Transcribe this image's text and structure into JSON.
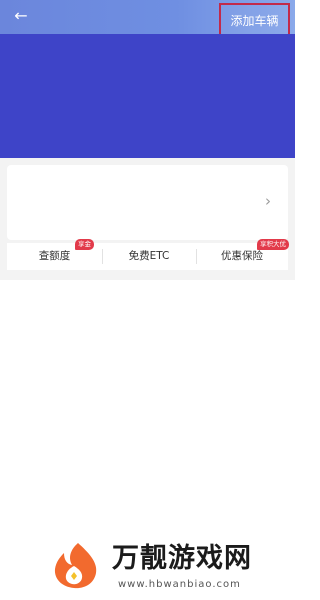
{
  "topbar": {
    "back_icon": "←",
    "add_vehicle_label": "添加车辆"
  },
  "card": {
    "chevron_icon": "›"
  },
  "services": [
    {
      "label": "查额度",
      "badge": "享金"
    },
    {
      "label": "免费ETC"
    },
    {
      "label": "优惠保险",
      "badge": "享积大优"
    }
  ],
  "watermark": {
    "title": "万靓游戏网",
    "url": "www.hbwanbiao.com"
  },
  "colors": {
    "header_blue": "#3e44c8",
    "topbar_blue": "#6f8fe2",
    "highlight_border": "#c22a4a",
    "badge_red": "#e23a4a",
    "logo_orange": "#f26a2e"
  }
}
